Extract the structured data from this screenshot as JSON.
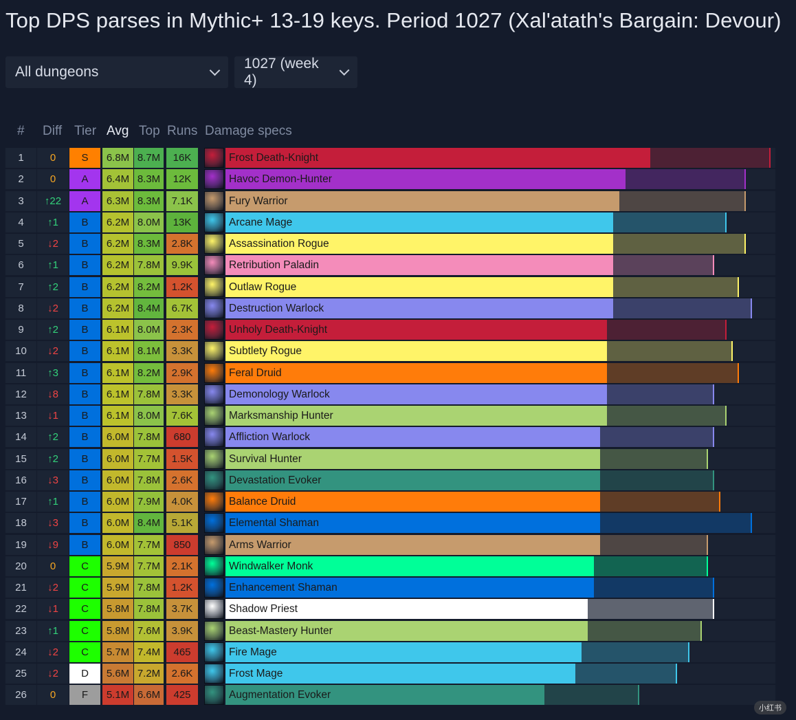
{
  "title": "Top DPS parses in Mythic+ 13-19 keys. Period 1027 (Xal'atath's Bargain: Devour)",
  "filters": {
    "dungeon": "All dungeons",
    "period": "1027 (week 4)"
  },
  "headers": {
    "rank": "#",
    "diff": "Diff",
    "tier": "Tier",
    "avg": "Avg",
    "top": "Top",
    "runs": "Runs",
    "specs": "Damage specs"
  },
  "tier_colors": {
    "S": "#ff8000",
    "A": "#a335ee",
    "B": "#0070dd",
    "C": "#1eff00",
    "D": "#ffffff",
    "F": "#9d9d9d"
  },
  "scale_max_millions": 8.8,
  "rows": [
    {
      "rank": "1",
      "diff": "0",
      "dir": "same",
      "tier": "S",
      "avg": "6.8M",
      "avgv": 6.8,
      "top": "8.7M",
      "topv": 8.7,
      "runs": "16K",
      "spec": "Frost Death-Knight",
      "color": "#c41e3a",
      "avgc": "#8bc34a",
      "topc": "#4caf50",
      "runc": "#4caf50",
      "icon": "frost-death-knight-icon"
    },
    {
      "rank": "2",
      "diff": "0",
      "dir": "same",
      "tier": "A",
      "avg": "6.4M",
      "avgv": 6.4,
      "top": "8.3M",
      "topv": 8.3,
      "runs": "12K",
      "spec": "Havoc Demon-Hunter",
      "color": "#a330c9",
      "avgc": "#a3c237",
      "topc": "#6cbb3c",
      "runc": "#6cbb3c",
      "icon": "havoc-demon-hunter-icon"
    },
    {
      "rank": "3",
      "diff": "↑22",
      "dir": "up",
      "tier": "A",
      "avg": "6.3M",
      "avgv": 6.3,
      "top": "8.3M",
      "topv": 8.3,
      "runs": "7.1K",
      "spec": "Fury Warrior",
      "color": "#c69b6d",
      "avgc": "#a9c235",
      "topc": "#6cbb3c",
      "runc": "#8bc34a",
      "icon": "fury-warrior-icon"
    },
    {
      "rank": "4",
      "diff": "↑1",
      "dir": "up",
      "tier": "B",
      "avg": "6.2M",
      "avgv": 6.2,
      "top": "8.0M",
      "topv": 8.0,
      "runs": "13K",
      "spec": "Arcane Mage",
      "color": "#3fc7eb",
      "avgc": "#b5c22f",
      "topc": "#8bc34a",
      "runc": "#5db23c",
      "icon": "arcane-mage-icon"
    },
    {
      "rank": "5",
      "diff": "↓2",
      "dir": "down",
      "tier": "B",
      "avg": "6.2M",
      "avgv": 6.2,
      "top": "8.3M",
      "topv": 8.3,
      "runs": "2.8K",
      "spec": "Assassination Rogue",
      "color": "#fff468",
      "avgc": "#b5c22f",
      "topc": "#6cbb3c",
      "runc": "#d4722e",
      "icon": "assassination-rogue-icon"
    },
    {
      "rank": "6",
      "diff": "↑1",
      "dir": "up",
      "tier": "B",
      "avg": "6.2M",
      "avgv": 6.2,
      "top": "7.8M",
      "topv": 7.8,
      "runs": "9.9K",
      "spec": "Retribution Paladin",
      "color": "#f48cba",
      "avgc": "#b5c22f",
      "topc": "#9bc23a",
      "runc": "#9bc23a",
      "icon": "retribution-paladin-icon"
    },
    {
      "rank": "7",
      "diff": "↑2",
      "dir": "up",
      "tier": "B",
      "avg": "6.2M",
      "avgv": 6.2,
      "top": "8.2M",
      "topv": 8.2,
      "runs": "1.2K",
      "spec": "Outlaw Rogue",
      "color": "#fff468",
      "avgc": "#b5c22f",
      "topc": "#74bd3d",
      "runc": "#d4522e",
      "icon": "outlaw-rogue-icon"
    },
    {
      "rank": "8",
      "diff": "↓2",
      "dir": "down",
      "tier": "B",
      "avg": "6.2M",
      "avgv": 6.2,
      "top": "8.4M",
      "topv": 8.4,
      "runs": "6.7K",
      "spec": "Destruction Warlock",
      "color": "#8788ee",
      "avgc": "#b5c22f",
      "topc": "#62b63e",
      "runc": "#a3c237",
      "icon": "destruction-warlock-icon"
    },
    {
      "rank": "9",
      "diff": "↑2",
      "dir": "up",
      "tier": "B",
      "avg": "6.1M",
      "avgv": 6.1,
      "top": "8.0M",
      "topv": 8.0,
      "runs": "2.3K",
      "spec": "Unholy Death-Knight",
      "color": "#c41e3a",
      "avgc": "#bcc22c",
      "topc": "#8bc34a",
      "runc": "#d4722e",
      "icon": "unholy-death-knight-icon"
    },
    {
      "rank": "10",
      "diff": "↓2",
      "dir": "down",
      "tier": "B",
      "avg": "6.1M",
      "avgv": 6.1,
      "top": "8.1M",
      "topv": 8.1,
      "runs": "3.3K",
      "spec": "Subtlety Rogue",
      "color": "#fff468",
      "avgc": "#bcc22c",
      "topc": "#7cbe3c",
      "runc": "#c7913a",
      "icon": "subtlety-rogue-icon"
    },
    {
      "rank": "11",
      "diff": "↑3",
      "dir": "up",
      "tier": "B",
      "avg": "6.1M",
      "avgv": 6.1,
      "top": "8.2M",
      "topv": 8.2,
      "runs": "2.9K",
      "spec": "Feral Druid",
      "color": "#ff7c0a",
      "avgc": "#bcc22c",
      "topc": "#74bd3d",
      "runc": "#d4722e",
      "icon": "feral-druid-icon"
    },
    {
      "rank": "12",
      "diff": "↓8",
      "dir": "down",
      "tier": "B",
      "avg": "6.1M",
      "avgv": 6.1,
      "top": "7.8M",
      "topv": 7.8,
      "runs": "3.3K",
      "spec": "Demonology Warlock",
      "color": "#8788ee",
      "avgc": "#bcc22c",
      "topc": "#9bc23a",
      "runc": "#c7913a",
      "icon": "demonology-warlock-icon"
    },
    {
      "rank": "13",
      "diff": "↓1",
      "dir": "down",
      "tier": "B",
      "avg": "6.1M",
      "avgv": 6.1,
      "top": "8.0M",
      "topv": 8.0,
      "runs": "7.6K",
      "spec": "Marksmanship Hunter",
      "color": "#aad372",
      "avgc": "#bcc22c",
      "topc": "#8bc34a",
      "runc": "#a3c237",
      "icon": "marksmanship-hunter-icon"
    },
    {
      "rank": "14",
      "diff": "↑2",
      "dir": "up",
      "tier": "B",
      "avg": "6.0M",
      "avgv": 6.0,
      "top": "7.8M",
      "topv": 7.8,
      "runs": "680",
      "spec": "Affliction Warlock",
      "color": "#8788ee",
      "avgc": "#c2b82c",
      "topc": "#9bc23a",
      "runc": "#cc3c2e",
      "icon": "affliction-warlock-icon"
    },
    {
      "rank": "15",
      "diff": "↑2",
      "dir": "up",
      "tier": "B",
      "avg": "6.0M",
      "avgv": 6.0,
      "top": "7.7M",
      "topv": 7.7,
      "runs": "1.5K",
      "spec": "Survival Hunter",
      "color": "#aad372",
      "avgc": "#c2b82c",
      "topc": "#a3c237",
      "runc": "#d4522e",
      "icon": "survival-hunter-icon"
    },
    {
      "rank": "16",
      "diff": "↓3",
      "dir": "down",
      "tier": "B",
      "avg": "6.0M",
      "avgv": 6.0,
      "top": "7.8M",
      "topv": 7.8,
      "runs": "2.6K",
      "spec": "Devastation Evoker",
      "color": "#33937f",
      "avgc": "#c2b82c",
      "topc": "#9bc23a",
      "runc": "#d4722e",
      "icon": "devastation-evoker-icon"
    },
    {
      "rank": "17",
      "diff": "↑1",
      "dir": "up",
      "tier": "B",
      "avg": "6.0M",
      "avgv": 6.0,
      "top": "7.9M",
      "topv": 7.9,
      "runs": "4.0K",
      "spec": "Balance Druid",
      "color": "#ff7c0a",
      "avgc": "#c2b82c",
      "topc": "#93c13b",
      "runc": "#c7913a",
      "icon": "balance-druid-icon"
    },
    {
      "rank": "18",
      "diff": "↓3",
      "dir": "down",
      "tier": "B",
      "avg": "6.0M",
      "avgv": 6.0,
      "top": "8.4M",
      "topv": 8.4,
      "runs": "5.1K",
      "spec": "Elemental Shaman",
      "color": "#0070dd",
      "avgc": "#c2b82c",
      "topc": "#62b63e",
      "runc": "#b8a836",
      "icon": "elemental-shaman-icon"
    },
    {
      "rank": "19",
      "diff": "↓9",
      "dir": "down",
      "tier": "B",
      "avg": "6.0M",
      "avgv": 6.0,
      "top": "7.7M",
      "topv": 7.7,
      "runs": "850",
      "spec": "Arms Warrior",
      "color": "#c69b6d",
      "avgc": "#c2b82c",
      "topc": "#a3c237",
      "runc": "#cc3c2e",
      "icon": "arms-warrior-icon"
    },
    {
      "rank": "20",
      "diff": "0",
      "dir": "same",
      "tier": "C",
      "avg": "5.9M",
      "avgv": 5.9,
      "top": "7.7M",
      "topv": 7.7,
      "runs": "2.1K",
      "spec": "Windwalker Monk",
      "color": "#00ff98",
      "avgc": "#c8a82e",
      "topc": "#a3c237",
      "runc": "#d4722e",
      "icon": "windwalker-monk-icon"
    },
    {
      "rank": "21",
      "diff": "↓2",
      "dir": "down",
      "tier": "C",
      "avg": "5.9M",
      "avgv": 5.9,
      "top": "7.8M",
      "topv": 7.8,
      "runs": "1.2K",
      "spec": "Enhancement Shaman",
      "color": "#0070dd",
      "avgc": "#c8a82e",
      "topc": "#9bc23a",
      "runc": "#d4522e",
      "icon": "enhancement-shaman-icon"
    },
    {
      "rank": "22",
      "diff": "↓1",
      "dir": "down",
      "tier": "C",
      "avg": "5.8M",
      "avgv": 5.8,
      "top": "7.8M",
      "topv": 7.8,
      "runs": "3.7K",
      "spec": "Shadow Priest",
      "color": "#ffffff",
      "avgc": "#c89a30",
      "topc": "#9bc23a",
      "runc": "#c7913a",
      "icon": "shadow-priest-icon"
    },
    {
      "rank": "23",
      "diff": "↑1",
      "dir": "up",
      "tier": "C",
      "avg": "5.8M",
      "avgv": 5.8,
      "top": "7.6M",
      "topv": 7.6,
      "runs": "3.9K",
      "spec": "Beast-Mastery Hunter",
      "color": "#aad372",
      "avgc": "#c89a30",
      "topc": "#b2c034",
      "runc": "#c7913a",
      "icon": "beast-mastery-hunter-icon"
    },
    {
      "rank": "24",
      "diff": "↓2",
      "dir": "down",
      "tier": "C",
      "avg": "5.7M",
      "avgv": 5.7,
      "top": "7.4M",
      "topv": 7.4,
      "runs": "465",
      "spec": "Fire Mage",
      "color": "#3fc7eb",
      "avgc": "#c88a32",
      "topc": "#c2b82c",
      "runc": "#cc3c2e",
      "icon": "fire-mage-icon"
    },
    {
      "rank": "25",
      "diff": "↓2",
      "dir": "down",
      "tier": "D",
      "avg": "5.6M",
      "avgv": 5.6,
      "top": "7.2M",
      "topv": 7.2,
      "runs": "2.6K",
      "spec": "Frost Mage",
      "color": "#3fc7eb",
      "avgc": "#c87a34",
      "topc": "#c8a82e",
      "runc": "#d4722e",
      "icon": "frost-mage-icon"
    },
    {
      "rank": "26",
      "diff": "0",
      "dir": "same",
      "tier": "F",
      "avg": "5.1M",
      "avgv": 5.1,
      "top": "6.6M",
      "topv": 6.6,
      "runs": "425",
      "spec": "Augmentation Evoker",
      "color": "#33937f",
      "avgc": "#cc3c2e",
      "topc": "#c86a36",
      "runc": "#cc3c2e",
      "icon": "augmentation-evoker-icon"
    }
  ],
  "watermark": "小红书"
}
